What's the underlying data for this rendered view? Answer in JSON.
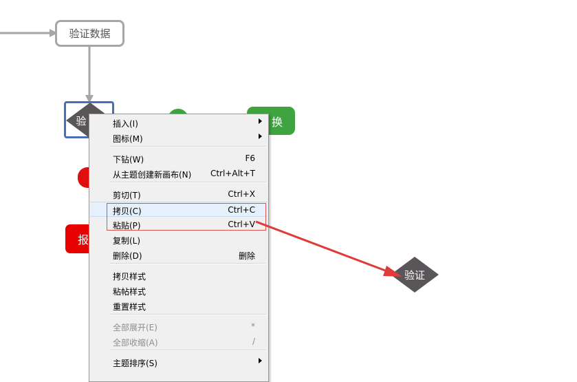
{
  "canvas": {
    "node_verify_data": "验证数据",
    "selected_topic": "验",
    "green_topic": "换",
    "red_topic": "报",
    "pasted_diamond": "验证",
    "colors": {
      "node_border": "#a6a6a6",
      "selected_border": "#4a6fb5",
      "green": "#3fa33f",
      "red": "#e60000",
      "diamond": "#5a5558",
      "arrow": "#e03a3a"
    }
  },
  "context_menu": {
    "items": [
      {
        "label": "插入(I)",
        "shortcut": "",
        "submenu": true,
        "disabled": false
      },
      {
        "label": "图标(M)",
        "shortcut": "",
        "submenu": true,
        "disabled": false
      },
      {
        "label": "下钻(W)",
        "shortcut": "F6",
        "submenu": false,
        "disabled": false
      },
      {
        "label": "从主题创建新画布(N)",
        "shortcut": "Ctrl+Alt+T",
        "submenu": false,
        "disabled": false
      },
      {
        "label": "剪切(T)",
        "shortcut": "Ctrl+X",
        "submenu": false,
        "disabled": false
      },
      {
        "label": "拷贝(C)",
        "shortcut": "Ctrl+C",
        "submenu": false,
        "disabled": false
      },
      {
        "label": "粘贴(P)",
        "shortcut": "Ctrl+V",
        "submenu": false,
        "disabled": false
      },
      {
        "label": "复制(L)",
        "shortcut": "",
        "submenu": false,
        "disabled": false
      },
      {
        "label": "删除(D)",
        "shortcut": "删除",
        "submenu": false,
        "disabled": false
      },
      {
        "label": "拷贝样式",
        "shortcut": "",
        "submenu": false,
        "disabled": false
      },
      {
        "label": "粘帖样式",
        "shortcut": "",
        "submenu": false,
        "disabled": false
      },
      {
        "label": "重置样式",
        "shortcut": "",
        "submenu": false,
        "disabled": false
      },
      {
        "label": "全部展开(E)",
        "shortcut": "*",
        "submenu": false,
        "disabled": true
      },
      {
        "label": "全部收缩(A)",
        "shortcut": "/",
        "submenu": false,
        "disabled": true
      },
      {
        "label": "主题排序(S)",
        "shortcut": "",
        "submenu": true,
        "disabled": false
      }
    ]
  }
}
